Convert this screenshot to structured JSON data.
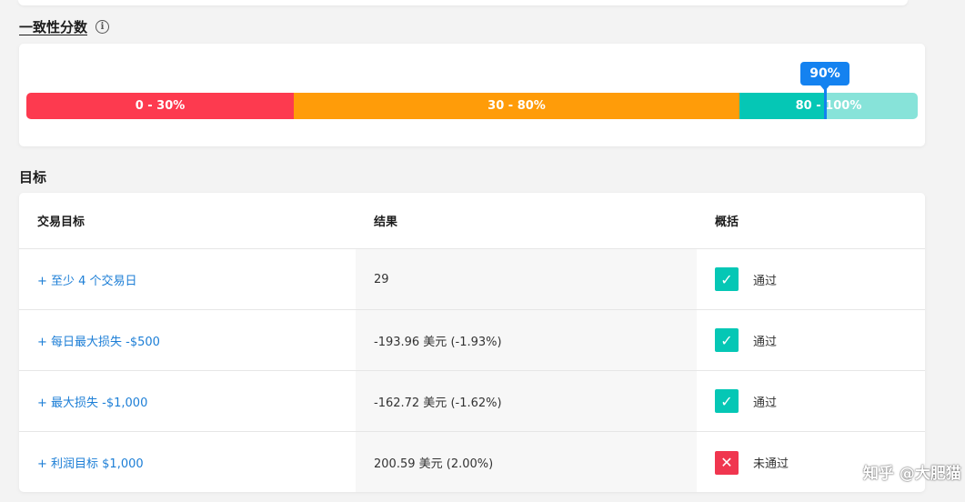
{
  "consistency": {
    "title": "一致性分数",
    "info_icon": "i",
    "segments": [
      {
        "label": "0 - 30%",
        "color": "#fd3a4f"
      },
      {
        "label": "30 - 80%",
        "color": "#ff9c09"
      },
      {
        "label": "80 - 100%",
        "color": "#05c7b5"
      }
    ],
    "marker_label": "90%",
    "marker_value": 90
  },
  "goals": {
    "title": "目标",
    "headers": [
      "交易目标",
      "结果",
      "概括"
    ],
    "rows": [
      {
        "goal": "+ 至少 4 个交易日",
        "result": "29",
        "status": "通过",
        "icon": "✓",
        "passed": true
      },
      {
        "goal": "+ 每日最大损失 -$500",
        "result": "-193.96 美元 (-1.93%)",
        "status": "通过",
        "icon": "✓",
        "passed": true
      },
      {
        "goal": "+ 最大损失 -$1,000",
        "result": "-162.72 美元 (-1.62%)",
        "status": "通过",
        "icon": "✓",
        "passed": true
      },
      {
        "goal": "+ 利润目标 $1,000",
        "result": "200.59 美元 (2.00%)",
        "status": "未通过",
        "icon": "✕",
        "passed": false
      }
    ]
  },
  "watermark": "知乎 @大肥猫",
  "colors": {
    "pass": "#05c7b5",
    "fail": "#f0364f",
    "link": "#1c7ed6",
    "marker": "#1482f0"
  }
}
